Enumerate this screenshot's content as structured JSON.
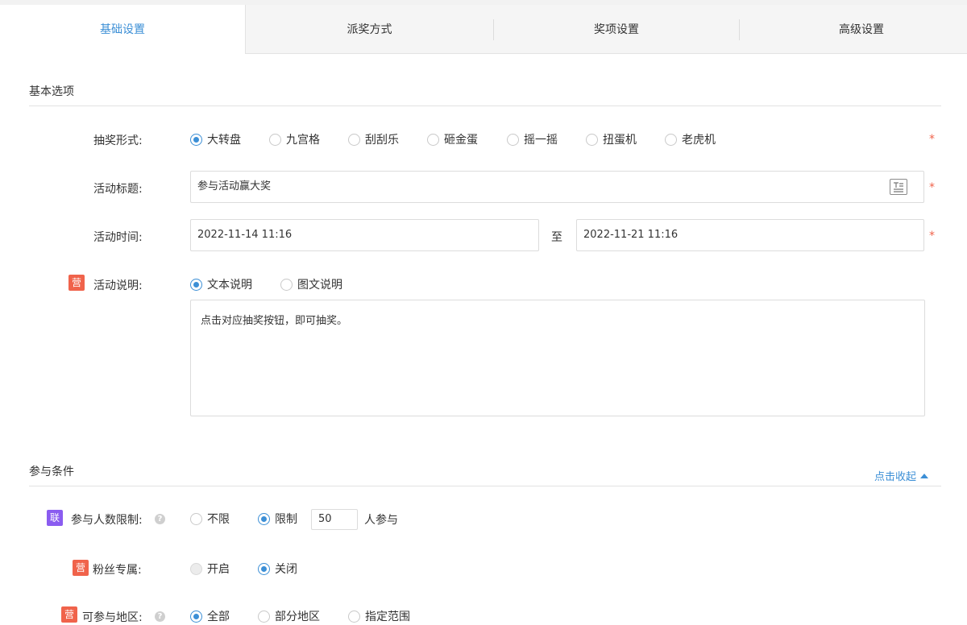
{
  "tabs": [
    {
      "label": "基础设置",
      "active": true
    },
    {
      "label": "派奖方式",
      "active": false
    },
    {
      "label": "奖项设置",
      "active": false
    },
    {
      "label": "高级设置",
      "active": false
    }
  ],
  "basic": {
    "section_title": "基本选项",
    "lottery_form": {
      "label": "抽奖形式:",
      "options": [
        "大转盘",
        "九宫格",
        "刮刮乐",
        "砸金蛋",
        "摇一摇",
        "扭蛋机",
        "老虎机"
      ],
      "selected": "大转盘"
    },
    "activity_title": {
      "label": "活动标题:",
      "value": "参与活动赢大奖"
    },
    "activity_time": {
      "label": "活动时间:",
      "start": "2022-11-14 11:16",
      "separator": "至",
      "end": "2022-11-21 11:16"
    },
    "activity_desc": {
      "badge": "营",
      "label": "活动说明:",
      "options": [
        "文本说明",
        "图文说明"
      ],
      "selected": "文本说明",
      "text": "点击对应抽奖按钮，即可抽奖。"
    },
    "required_mark": "*"
  },
  "conditions": {
    "section_title": "参与条件",
    "collapse_label": "点击收起",
    "participant_limit": {
      "badge": "联",
      "label": "参与人数限制:",
      "options": [
        "不限",
        "限制"
      ],
      "selected": "限制",
      "limit_value": "50",
      "suffix": "人参与"
    },
    "fans_only": {
      "badge": "营",
      "label": "粉丝专属:",
      "options": [
        "开启",
        "关闭"
      ],
      "selected": "关闭"
    },
    "region": {
      "badge": "营",
      "label": "可参与地区:",
      "options": [
        "全部",
        "部分地区",
        "指定范围"
      ],
      "selected": "全部"
    }
  },
  "colors": {
    "accent": "#3c8fd6",
    "required": "#f0634b",
    "badge_red": "#f0634b",
    "badge_purple": "#8a5cf0"
  }
}
